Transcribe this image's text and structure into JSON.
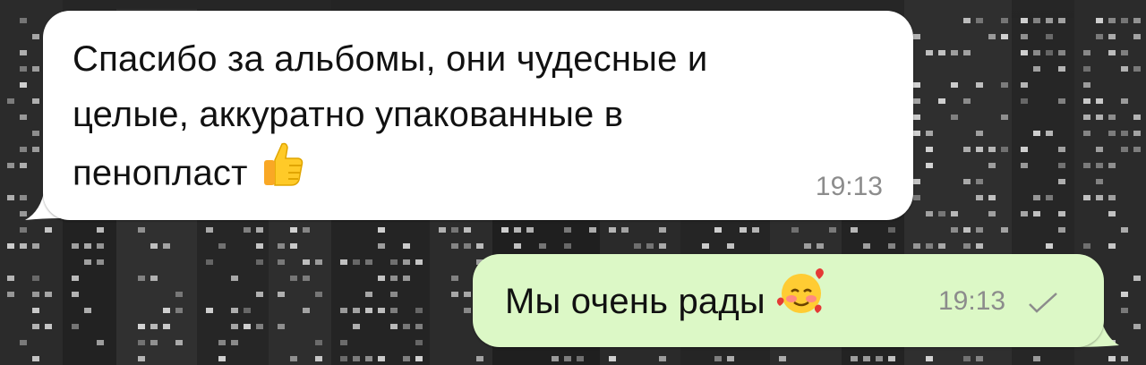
{
  "chat": {
    "messages": [
      {
        "direction": "incoming",
        "lines": [
          "Спасибо за альбомы, они чудесные и",
          "целые, аккуратно упакованные в",
          "пенопласт"
        ],
        "emoji": "thumbs-up",
        "time": "19:13"
      },
      {
        "direction": "outgoing",
        "text": "Мы очень рады",
        "emoji": "smiling-face-with-hearts",
        "time": "19:13",
        "status": "sent-check"
      }
    ]
  },
  "colors": {
    "incoming_bubble": "#ffffff",
    "outgoing_bubble": "#dcf8c6",
    "timestamp": "#8c8c8c",
    "message_text": "#111111",
    "wallpaper": "#1a1a1a"
  }
}
